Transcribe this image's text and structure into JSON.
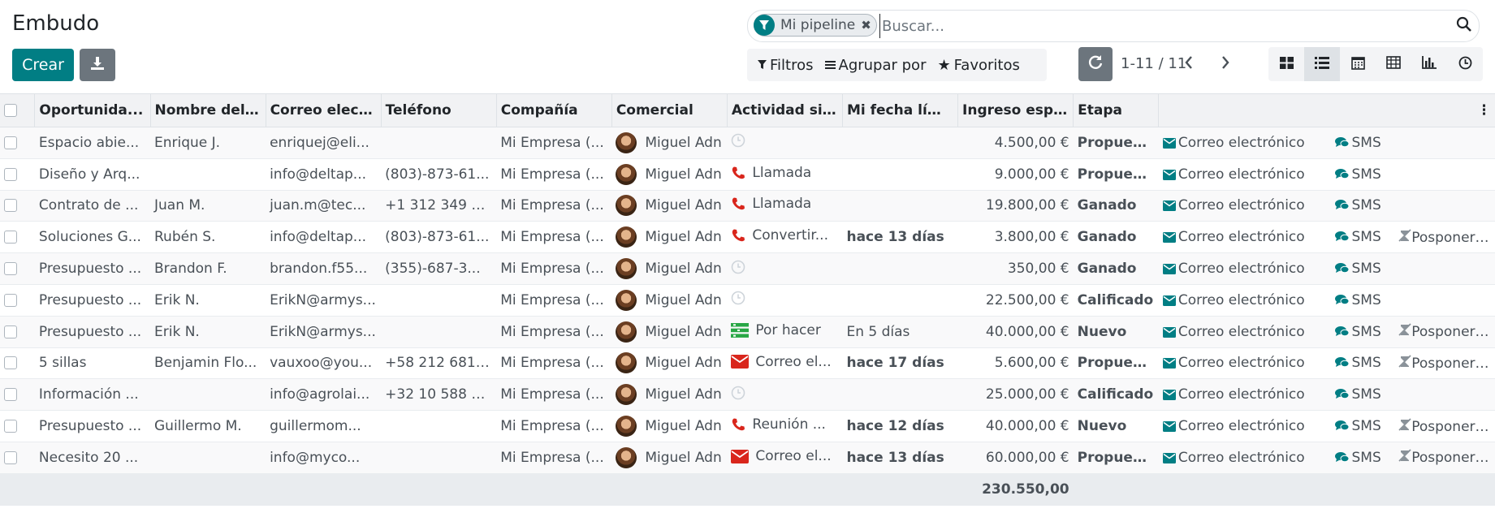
{
  "page": {
    "title": "Embudo"
  },
  "toolbar": {
    "create_label": "Crear",
    "download_icon": "download-icon"
  },
  "search": {
    "facet_label": "Mi pipeline",
    "facet_icon": "filter-icon",
    "placeholder": "Buscar..."
  },
  "filters": {
    "filters_label": "Filtros",
    "groupby_label": "Agrupar por",
    "favorites_label": "Favoritos"
  },
  "pager": {
    "value": "1-11 / 11"
  },
  "views": [
    "kanban",
    "list",
    "calendar",
    "pivot",
    "graph",
    "activity"
  ],
  "active_view": "list",
  "colors": {
    "accent": "#017e84",
    "late": "#d9261c",
    "header_bg": "#f1f2f4"
  },
  "table": {
    "columns": [
      "Oportunidad",
      "Nombre del contacto",
      "Correo electrónico",
      "Teléfono",
      "Compañía",
      "Comercial",
      "Actividad siguiente",
      "Mi fecha límite",
      "Ingreso esperado",
      "Etapa"
    ],
    "column_display": [
      "Oportunida...",
      "Nombre del ...",
      "Correo elect...",
      "Teléfono",
      "Compañía",
      "Comercial",
      "Actividad si...",
      "Mi fecha lími...",
      "Ingreso esp...",
      "Etapa"
    ],
    "email_action": "Correo electrónico",
    "sms_action": "SMS",
    "snooze_action": "Posponer 7d",
    "rows": [
      {
        "name": "Espacio abie...",
        "contact": "Enrique J.",
        "email": "enriquej@eli...",
        "phone": "",
        "company": "Mi Empresa (...",
        "user": "Miguel Adn",
        "activity_icon": "clock",
        "activity": "",
        "deadline": "",
        "deadline_late": false,
        "revenue": "4.500,00 €",
        "stage": "Propuesta",
        "snooze": false
      },
      {
        "name": "Diseño y Arq...",
        "contact": "",
        "email": "info@deltap...",
        "phone": "(803)-873-61...",
        "company": "Mi Empresa (...",
        "user": "Miguel Adn",
        "activity_icon": "phone",
        "activity": "Llamada",
        "deadline": "",
        "deadline_late": false,
        "revenue": "9.000,00 €",
        "stage": "Propuesta",
        "snooze": false
      },
      {
        "name": "Contrato de ...",
        "contact": "Juan M.",
        "email": "juan.m@tec...",
        "phone": "+1 312 349 23...",
        "company": "Mi Empresa (...",
        "user": "Miguel Adn",
        "activity_icon": "phone",
        "activity": "Llamada",
        "deadline": "",
        "deadline_late": false,
        "revenue": "19.800,00 €",
        "stage": "Ganado",
        "snooze": false
      },
      {
        "name": "Soluciones G...",
        "contact": "Rubén S.",
        "email": "info@deltap...",
        "phone": "(803)-873-61...",
        "company": "Mi Empresa (...",
        "user": "Miguel Adn",
        "activity_icon": "phone",
        "activity": "Convertir...",
        "deadline": "hace 13 días",
        "deadline_late": true,
        "revenue": "3.800,00 €",
        "stage": "Ganado",
        "snooze": true
      },
      {
        "name": "Presupuesto ...",
        "contact": "Brandon F.",
        "email": "brandon.f55...",
        "phone": "(355)-687-3...",
        "company": "Mi Empresa (...",
        "user": "Miguel Adn",
        "activity_icon": "clock",
        "activity": "",
        "deadline": "",
        "deadline_late": false,
        "revenue": "350,00 €",
        "stage": "Ganado",
        "snooze": false
      },
      {
        "name": "Presupuesto ...",
        "contact": "Erik N.",
        "email": "ErikN@armys...",
        "phone": "",
        "company": "Mi Empresa (...",
        "user": "Miguel Adn",
        "activity_icon": "clock",
        "activity": "",
        "deadline": "",
        "deadline_late": false,
        "revenue": "22.500,00 €",
        "stage": "Calificado",
        "snooze": false
      },
      {
        "name": "Presupuesto ...",
        "contact": "Erik N.",
        "email": "ErikN@armys...",
        "phone": "",
        "company": "Mi Empresa (...",
        "user": "Miguel Adn",
        "activity_icon": "tasks",
        "activity": "Por hacer",
        "deadline": "En 5 días",
        "deadline_late": false,
        "revenue": "40.000,00 €",
        "stage": "Nuevo",
        "snooze": true
      },
      {
        "name": "5 sillas",
        "contact": "Benjamin Flo...",
        "email": "vauxoo@you...",
        "phone": "+58 212 681 0...",
        "company": "Mi Empresa (...",
        "user": "Miguel Adn",
        "activity_icon": "envelope",
        "activity": "Correo el...",
        "deadline": "hace 17 días",
        "deadline_late": true,
        "revenue": "5.600,00 €",
        "stage": "Propuesta",
        "snooze": true
      },
      {
        "name": "Información ...",
        "contact": "",
        "email": "info@agrolai...",
        "phone": "+32 10 588 5...",
        "company": "Mi Empresa (...",
        "user": "Miguel Adn",
        "activity_icon": "clock",
        "activity": "",
        "deadline": "",
        "deadline_late": false,
        "revenue": "25.000,00 €",
        "stage": "Calificado",
        "snooze": false
      },
      {
        "name": "Presupuesto ...",
        "contact": "Guillermo M.",
        "email": "guillermom...",
        "phone": "",
        "company": "Mi Empresa (...",
        "user": "Miguel Adn",
        "activity_icon": "phone",
        "activity": "Reunión ...",
        "deadline": "hace 12 días",
        "deadline_late": true,
        "revenue": "40.000,00 €",
        "stage": "Nuevo",
        "snooze": true
      },
      {
        "name": "Necesito 20 ...",
        "contact": "",
        "email": "info@myco...",
        "phone": "",
        "company": "Mi Empresa (...",
        "user": "Miguel Adn",
        "activity_icon": "envelope",
        "activity": "Correo el...",
        "deadline": "hace 13 días",
        "deadline_late": true,
        "revenue": "60.000,00 €",
        "stage": "Propuesta",
        "snooze": true
      }
    ],
    "total_revenue": "230.550,00"
  }
}
